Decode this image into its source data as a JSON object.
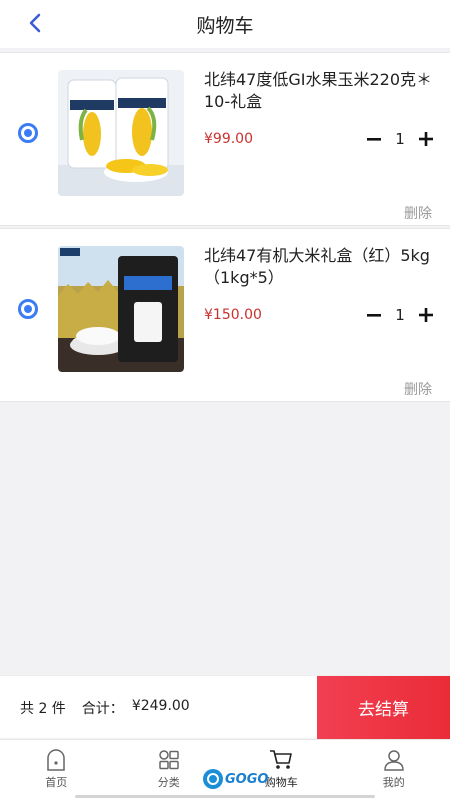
{
  "header": {
    "title": "购物车"
  },
  "cart": {
    "items": [
      {
        "name": "北纬47度低GI水果玉米220克＊10-礼盒",
        "price": "¥99.00",
        "quantity": "1",
        "delete_label": "删除",
        "selected": true
      },
      {
        "name": "北纬47有机大米礼盒（红）5kg（1kg*5）",
        "price": "¥150.00",
        "quantity": "1",
        "delete_label": "删除",
        "selected": true
      }
    ]
  },
  "checkout": {
    "count_label": "共 2 件",
    "total_label": "合计：",
    "total_value": "¥249.00",
    "button_label": "去结算"
  },
  "tabbar": {
    "items": [
      {
        "label": "首页",
        "icon": "home-icon"
      },
      {
        "label": "分类",
        "icon": "category-icon"
      },
      {
        "label": "购物车",
        "icon": "cart-icon"
      },
      {
        "label": "我的",
        "icon": "profile-icon"
      }
    ]
  },
  "watermark": {
    "text": "GOGO"
  },
  "colors": {
    "accent": "#3b7cf5",
    "price": "#c8322e",
    "checkout": "#ea2c37",
    "background": "#f2f2f4"
  }
}
